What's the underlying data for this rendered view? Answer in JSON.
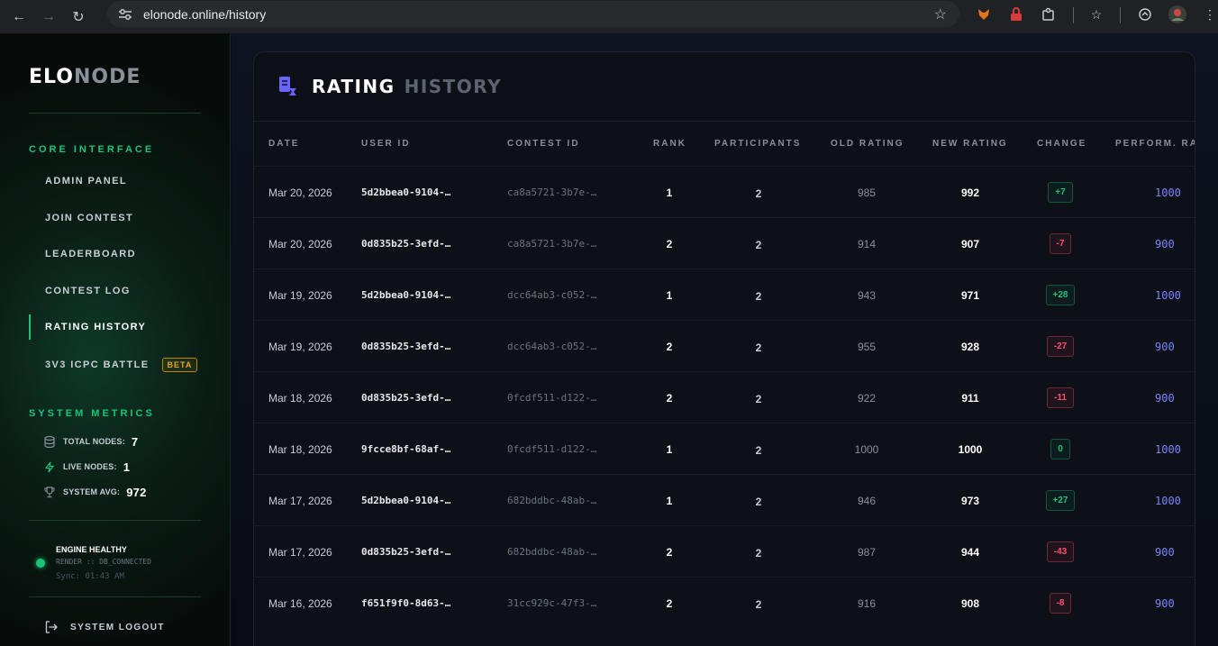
{
  "browser": {
    "url": "elonode.online/history"
  },
  "sidebar": {
    "logo_a": "ELO",
    "logo_b": "NODE",
    "core_title": "CORE INTERFACE",
    "items": [
      {
        "label": "ADMIN PANEL"
      },
      {
        "label": "JOIN CONTEST"
      },
      {
        "label": "LEADERBOARD"
      },
      {
        "label": "CONTEST LOG"
      },
      {
        "label": "RATING HISTORY",
        "active": true
      },
      {
        "label": "3V3 ICPC BATTLE",
        "badge": "BETA"
      }
    ],
    "metrics_title": "SYSTEM METRICS",
    "metrics": [
      {
        "label": "TOTAL NODES:",
        "value": "7",
        "icon": "database-icon"
      },
      {
        "label": "LIVE NODES:",
        "value": "1",
        "icon": "lightning-icon"
      },
      {
        "label": "SYSTEM AVG:",
        "value": "972",
        "icon": "trophy-icon"
      }
    ],
    "status": {
      "title": "ENGINE HEALTHY",
      "sub": "RENDER :: DB_CONNECTED",
      "sync": "Sync: 01:43 AM"
    },
    "logout": "SYSTEM LOGOUT"
  },
  "panel": {
    "title_a": "RATING",
    "title_b": "HISTORY",
    "columns": [
      "DATE",
      "USER ID",
      "CONTEST ID",
      "RANK",
      "PARTICIPANTS",
      "OLD RATING",
      "NEW RATING",
      "CHANGE",
      "PERFORM. RA"
    ],
    "rows": [
      {
        "date": "Mar 20, 2026",
        "user": "5d2bbea0-9104-…",
        "contest": "ca8a5721-3b7e-…",
        "rank": "1",
        "participants": "2",
        "old": "985",
        "new": "992",
        "change": "+7",
        "sign": "pos",
        "perf": "1000"
      },
      {
        "date": "Mar 20, 2026",
        "user": "0d835b25-3efd-…",
        "contest": "ca8a5721-3b7e-…",
        "rank": "2",
        "participants": "2",
        "old": "914",
        "new": "907",
        "change": "-7",
        "sign": "neg",
        "perf": "900"
      },
      {
        "date": "Mar 19, 2026",
        "user": "5d2bbea0-9104-…",
        "contest": "dcc64ab3-c052-…",
        "rank": "1",
        "participants": "2",
        "old": "943",
        "new": "971",
        "change": "+28",
        "sign": "pos",
        "perf": "1000"
      },
      {
        "date": "Mar 19, 2026",
        "user": "0d835b25-3efd-…",
        "contest": "dcc64ab3-c052-…",
        "rank": "2",
        "participants": "2",
        "old": "955",
        "new": "928",
        "change": "-27",
        "sign": "neg",
        "perf": "900"
      },
      {
        "date": "Mar 18, 2026",
        "user": "0d835b25-3efd-…",
        "contest": "0fcdf511-d122-…",
        "rank": "2",
        "participants": "2",
        "old": "922",
        "new": "911",
        "change": "-11",
        "sign": "neg",
        "perf": "900"
      },
      {
        "date": "Mar 18, 2026",
        "user": "9fcce8bf-68af-…",
        "contest": "0fcdf511-d122-…",
        "rank": "1",
        "participants": "2",
        "old": "1000",
        "new": "1000",
        "change": "0",
        "sign": "pos",
        "perf": "1000"
      },
      {
        "date": "Mar 17, 2026",
        "user": "5d2bbea0-9104-…",
        "contest": "682bddbc-48ab-…",
        "rank": "1",
        "participants": "2",
        "old": "946",
        "new": "973",
        "change": "+27",
        "sign": "pos",
        "perf": "1000"
      },
      {
        "date": "Mar 17, 2026",
        "user": "0d835b25-3efd-…",
        "contest": "682bddbc-48ab-…",
        "rank": "2",
        "participants": "2",
        "old": "987",
        "new": "944",
        "change": "-43",
        "sign": "neg",
        "perf": "900"
      },
      {
        "date": "Mar 16, 2026",
        "user": "f651f9f0-8d63-…",
        "contest": "31cc929c-47f3-…",
        "rank": "2",
        "participants": "2",
        "old": "916",
        "new": "908",
        "change": "-8",
        "sign": "neg",
        "perf": "900"
      }
    ]
  },
  "colors": {
    "accent": "#19c47a",
    "negative": "#ff4d6d",
    "perf": "#7b83ff",
    "beta": "#e0a526"
  }
}
